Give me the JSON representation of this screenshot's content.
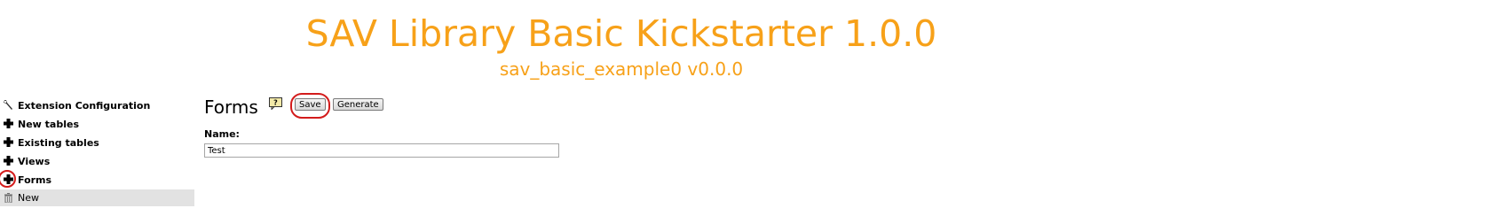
{
  "header": {
    "title": "SAV Library Basic Kickstarter 1.0.0",
    "subtitle": "sav_basic_example0 v0.0.0"
  },
  "sidebar": {
    "items": [
      {
        "label": "Extension Configuration",
        "icon": "wrench-icon"
      },
      {
        "label": "New tables",
        "icon": "plus-icon"
      },
      {
        "label": "Existing tables",
        "icon": "plus-icon"
      },
      {
        "label": "Views",
        "icon": "plus-icon"
      },
      {
        "label": "Forms",
        "icon": "plus-icon"
      },
      {
        "label": "New",
        "icon": "trash-icon"
      }
    ]
  },
  "form": {
    "heading": "Forms",
    "save_label": "Save",
    "generate_label": "Generate",
    "name_label": "Name:",
    "name_value": "Test"
  },
  "colors": {
    "header": "#f7a119",
    "highlight": "#d31b1b",
    "selected_bg": "#e2e2e2"
  }
}
